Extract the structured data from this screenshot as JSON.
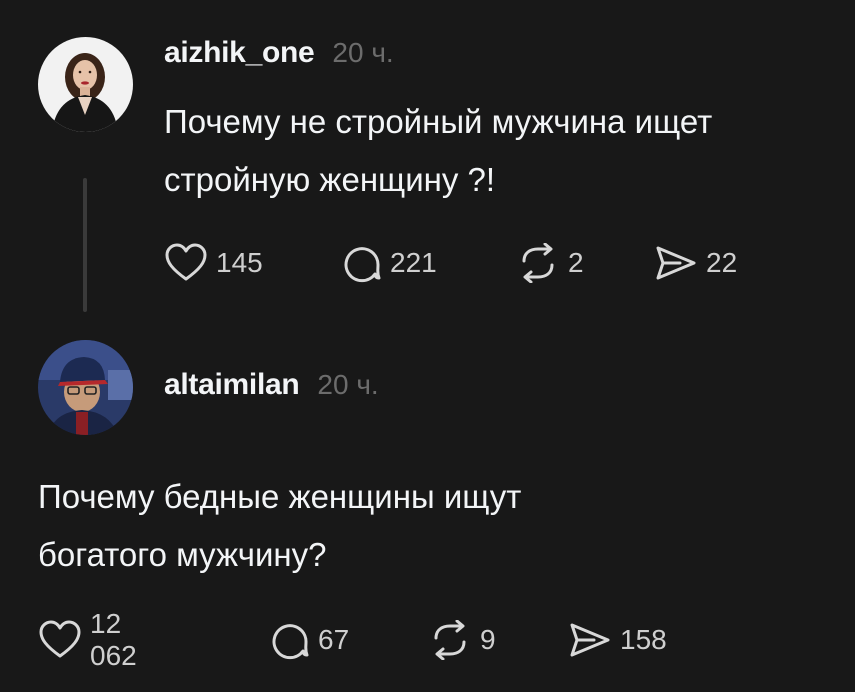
{
  "posts": [
    {
      "username": "aizhik_one",
      "time": "20 ч.",
      "text_lines": [
        "Почему не стройный мужчина ищет",
        "стройную женщину ?!"
      ],
      "likes": "145",
      "replies": "221",
      "reposts": "2",
      "shares": "22"
    },
    {
      "username": "altaimilan",
      "time": "20 ч.",
      "text_lines": [
        "Почему бедные женщины ищут",
        "богатого мужчину?"
      ],
      "likes": "12 062",
      "replies": "67",
      "reposts": "9",
      "shares": "158"
    }
  ],
  "icons": {
    "like": "heart-icon",
    "reply": "comment-bubble-icon",
    "repost": "repost-arrows-icon",
    "share": "send-paper-plane-icon"
  },
  "colors": {
    "background": "#181818",
    "text": "#f3f5f7",
    "muted": "#6c6c6c",
    "thread_line": "#3a3a3a"
  }
}
